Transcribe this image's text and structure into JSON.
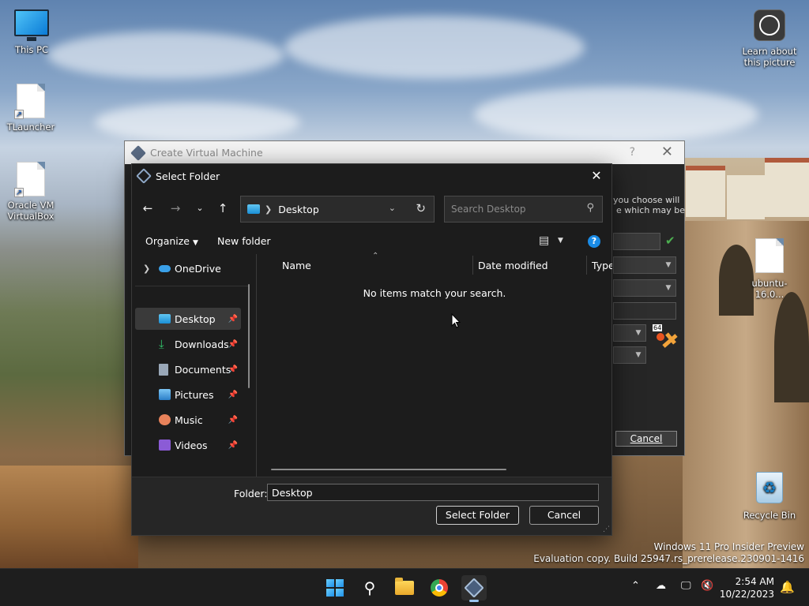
{
  "desktop": {
    "icons": [
      {
        "label": "This PC"
      },
      {
        "label": "TLauncher"
      },
      {
        "label": "Oracle VM VirtualBox"
      },
      {
        "label": "Learn about this picture"
      },
      {
        "label": "ubuntu-16.0..."
      },
      {
        "label": "Recycle Bin"
      }
    ],
    "watermark": {
      "line1": "Windows 11 Pro Insider Preview",
      "line2": "Evaluation copy. Build 25947.rs_prerelease.230901-1416"
    }
  },
  "vbox_window": {
    "title": "Create Virtual Machine",
    "help": "?",
    "text_fragment_1": "you choose will",
    "text_fragment_2": "e which may be",
    "os_badge": "64",
    "cancel_label": "Cancel"
  },
  "dialog": {
    "title": "Select Folder",
    "address": {
      "current": "Desktop"
    },
    "search": {
      "placeholder": "Search Desktop"
    },
    "toolbar": {
      "organize": "Organize",
      "new_folder": "New folder"
    },
    "nav_pane": {
      "items": [
        {
          "label": "OneDrive",
          "icon": "cloud-icon",
          "pinned": false
        },
        {
          "label": "Desktop",
          "icon": "desktop-folder-icon",
          "pinned": true,
          "selected": true
        },
        {
          "label": "Downloads",
          "icon": "download-icon",
          "pinned": true
        },
        {
          "label": "Documents",
          "icon": "document-icon",
          "pinned": true
        },
        {
          "label": "Pictures",
          "icon": "picture-icon",
          "pinned": true
        },
        {
          "label": "Music",
          "icon": "music-icon",
          "pinned": true
        },
        {
          "label": "Videos",
          "icon": "video-icon",
          "pinned": true
        }
      ]
    },
    "columns": [
      "Name",
      "Date modified",
      "Type"
    ],
    "empty_message": "No items match your search.",
    "folder_label": "Folder:",
    "folder_value": "Desktop",
    "select_button": "Select Folder",
    "cancel_button": "Cancel"
  },
  "taskbar": {
    "apps": [
      "start-icon",
      "search-icon",
      "file-explorer-icon",
      "chrome-icon",
      "virtualbox-icon"
    ],
    "clock": {
      "time": "2:54 AM",
      "date": "10/22/2023"
    }
  },
  "colors": {
    "dialog_bg": "#1c1c1c",
    "accent": "#1a8be6",
    "taskbar_bg": "#1e1e1e"
  }
}
